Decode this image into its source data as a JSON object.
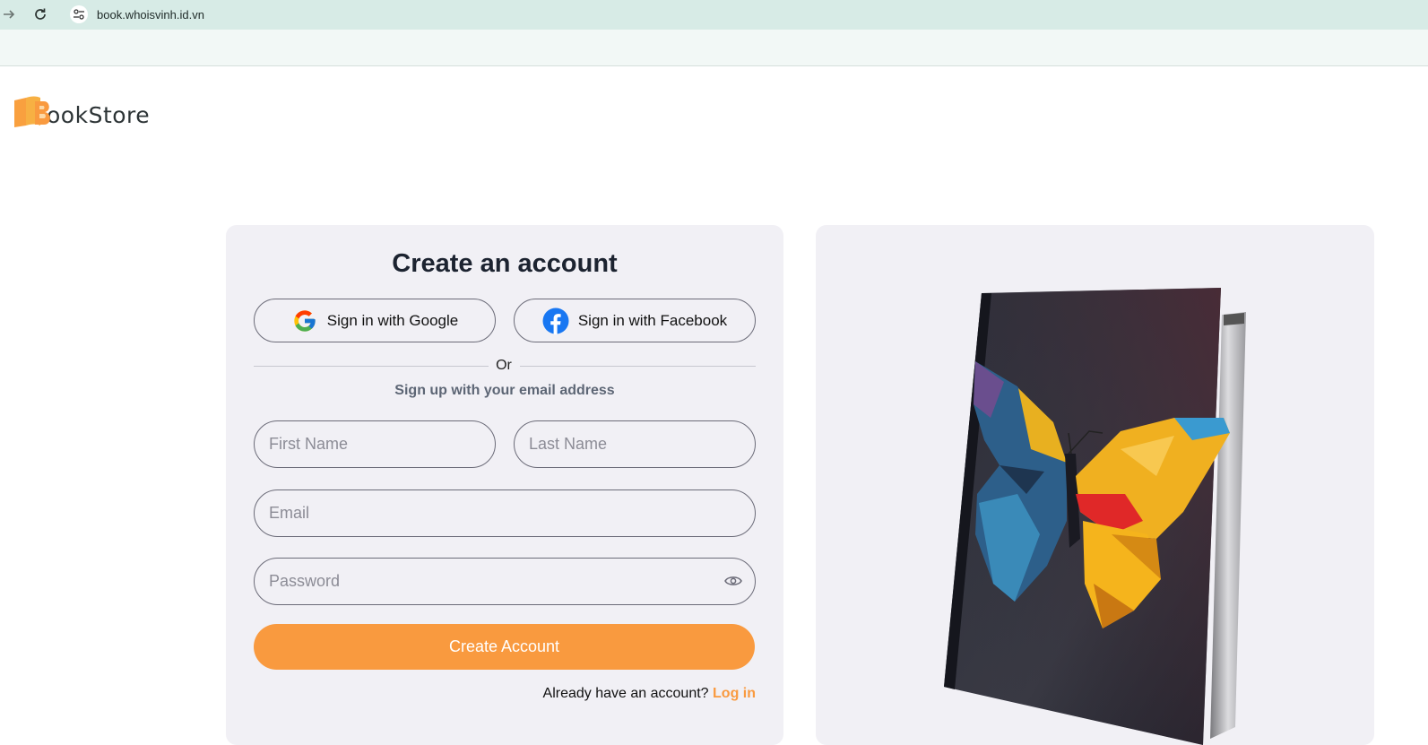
{
  "browser": {
    "url": "book.whoisvinh.id.vn",
    "forward_icon": "arrow-right-icon",
    "reload_icon": "reload-icon",
    "site_info_icon": "site-settings-icon"
  },
  "logo": {
    "text": "ookStore",
    "letter": "B",
    "color": "#f99a3f"
  },
  "form": {
    "title": "Create an account",
    "google_button": "Sign in with Google",
    "facebook_button": "Sign in with Facebook",
    "divider": "Or",
    "subtitle": "Sign up with your email address",
    "first_name_placeholder": "First Name",
    "last_name_placeholder": "Last Name",
    "email_placeholder": "Email",
    "password_placeholder": "Password",
    "submit": "Create Account",
    "login_prompt": "Already have an account?",
    "login_link": "Log in"
  },
  "colors": {
    "accent": "#f99a3f",
    "card_bg": "#f1f0f5",
    "browser_bar": "#d7ebe6"
  }
}
